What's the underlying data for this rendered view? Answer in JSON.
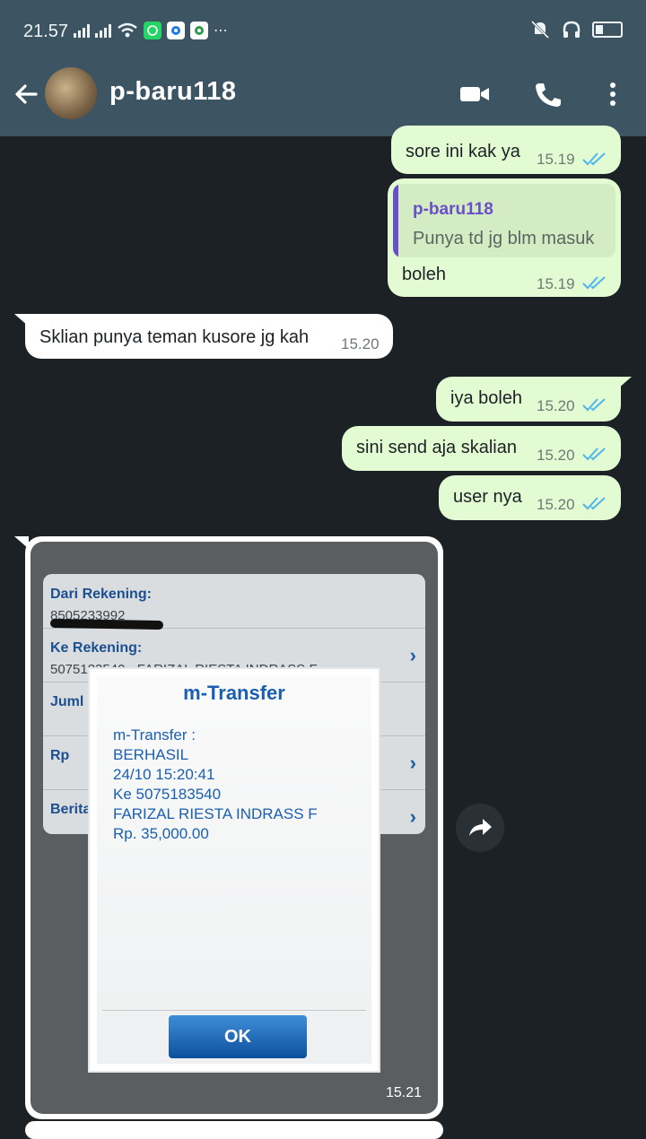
{
  "status_bar": {
    "time": "21.57"
  },
  "header": {
    "contact_name": "p-baru118"
  },
  "messages": [
    {
      "text": "sore ini kak ya",
      "time": "15.19"
    },
    {
      "quote_author": "p-baru118",
      "quote_text": "Punya td jg blm masuk",
      "text": "boleh",
      "time": "15.19"
    },
    {
      "text": "Sklian punya teman kusore jg kah",
      "time": "15.20"
    },
    {
      "text": "iya boleh",
      "time": "15.20"
    },
    {
      "text": "sini send aja skalian",
      "time": "15.20"
    },
    {
      "text": "user nya",
      "time": "15.20"
    }
  ],
  "image_message": {
    "time": "15.21",
    "form": {
      "from_label": "Dari Rekening:",
      "from_value": "8505233992",
      "to_label": "Ke Rekening:",
      "to_value": "5075183540 - FARIZAL RIESTA INDRASS F",
      "amount_label": "Juml",
      "rp_label": "Rp",
      "note_label": "Berita"
    },
    "dialog": {
      "title": "m-Transfer",
      "lines": [
        "m-Transfer :",
        "BERHASIL",
        "24/10 15:20:41",
        "Ke 5075183540",
        "FARIZAL RIESTA INDRASS F",
        "Rp. 35,000.00"
      ],
      "ok_label": "OK"
    }
  },
  "icons": {
    "back": "arrow-left-icon",
    "video": "video-call-icon",
    "call": "phone-icon",
    "menu": "more-vert-icon",
    "forward": "forward-icon",
    "read": "double-check-icon"
  },
  "colors": {
    "header": "#3d5563",
    "chat_bg": "#1c2125",
    "outgoing": "#e3fbd3",
    "incoming": "#ffffff",
    "tick": "#4fb6ec",
    "quote_accent": "#6a4fc6"
  }
}
